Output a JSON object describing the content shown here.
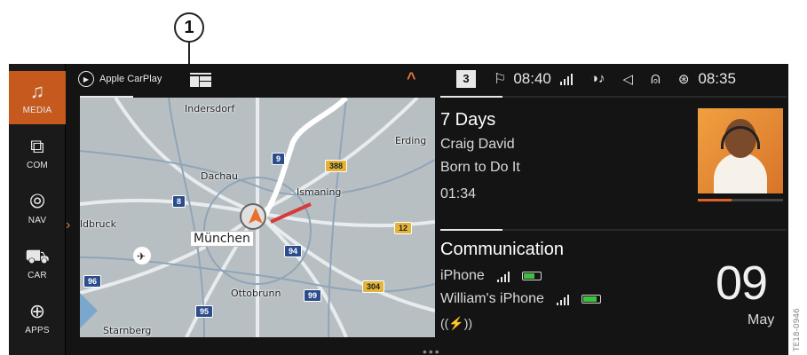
{
  "callout": {
    "number": "1"
  },
  "side_code": "TE18-0946",
  "nav": {
    "items": [
      {
        "label": "MEDIA",
        "icon": "music-note-icon",
        "glyph": "♫",
        "active": true
      },
      {
        "label": "COM",
        "icon": "message-icon",
        "glyph": "⧉",
        "active": false
      },
      {
        "label": "NAV",
        "icon": "navigation-icon",
        "glyph": "⦾",
        "active": false
      },
      {
        "label": "CAR",
        "icon": "car-icon",
        "glyph": "⛟",
        "active": false
      },
      {
        "label": "APPS",
        "icon": "globe-icon",
        "glyph": "⊕",
        "active": false
      }
    ]
  },
  "statusbar": {
    "carplay_label": "Apple CarPlay",
    "badge": "3",
    "nav_time": "08:40",
    "clock": "08:35"
  },
  "map": {
    "labels": {
      "indersdorf": "Indersdorf",
      "erding": "Erding",
      "dachau": "Dachau",
      "ismaning": "Ismaning",
      "furstenfeldbruck": "ldbruck",
      "munchen": "München",
      "ottobrunn": "Ottobrunn",
      "starnberg": "Starnberg"
    },
    "shields": {
      "a9": "9",
      "b388": "388",
      "a8": "8",
      "b12": "12",
      "a94": "94",
      "a96": "96",
      "b304": "304",
      "a99": "99",
      "a95": "95"
    }
  },
  "media": {
    "song": "7 Days",
    "artist": "Craig David",
    "album": "Born to Do It",
    "time": "01:34",
    "progress": 0.4
  },
  "communication": {
    "title": "Communication",
    "phones": [
      {
        "name": "iPhone",
        "battery": 0.7
      },
      {
        "name": "William's iPhone",
        "battery": 0.85
      }
    ],
    "wireless_glyph": "((⚡))",
    "day": "09",
    "month": "May"
  },
  "colors": {
    "accent": "#c65a1e",
    "battery_green": "#3cc23c"
  }
}
